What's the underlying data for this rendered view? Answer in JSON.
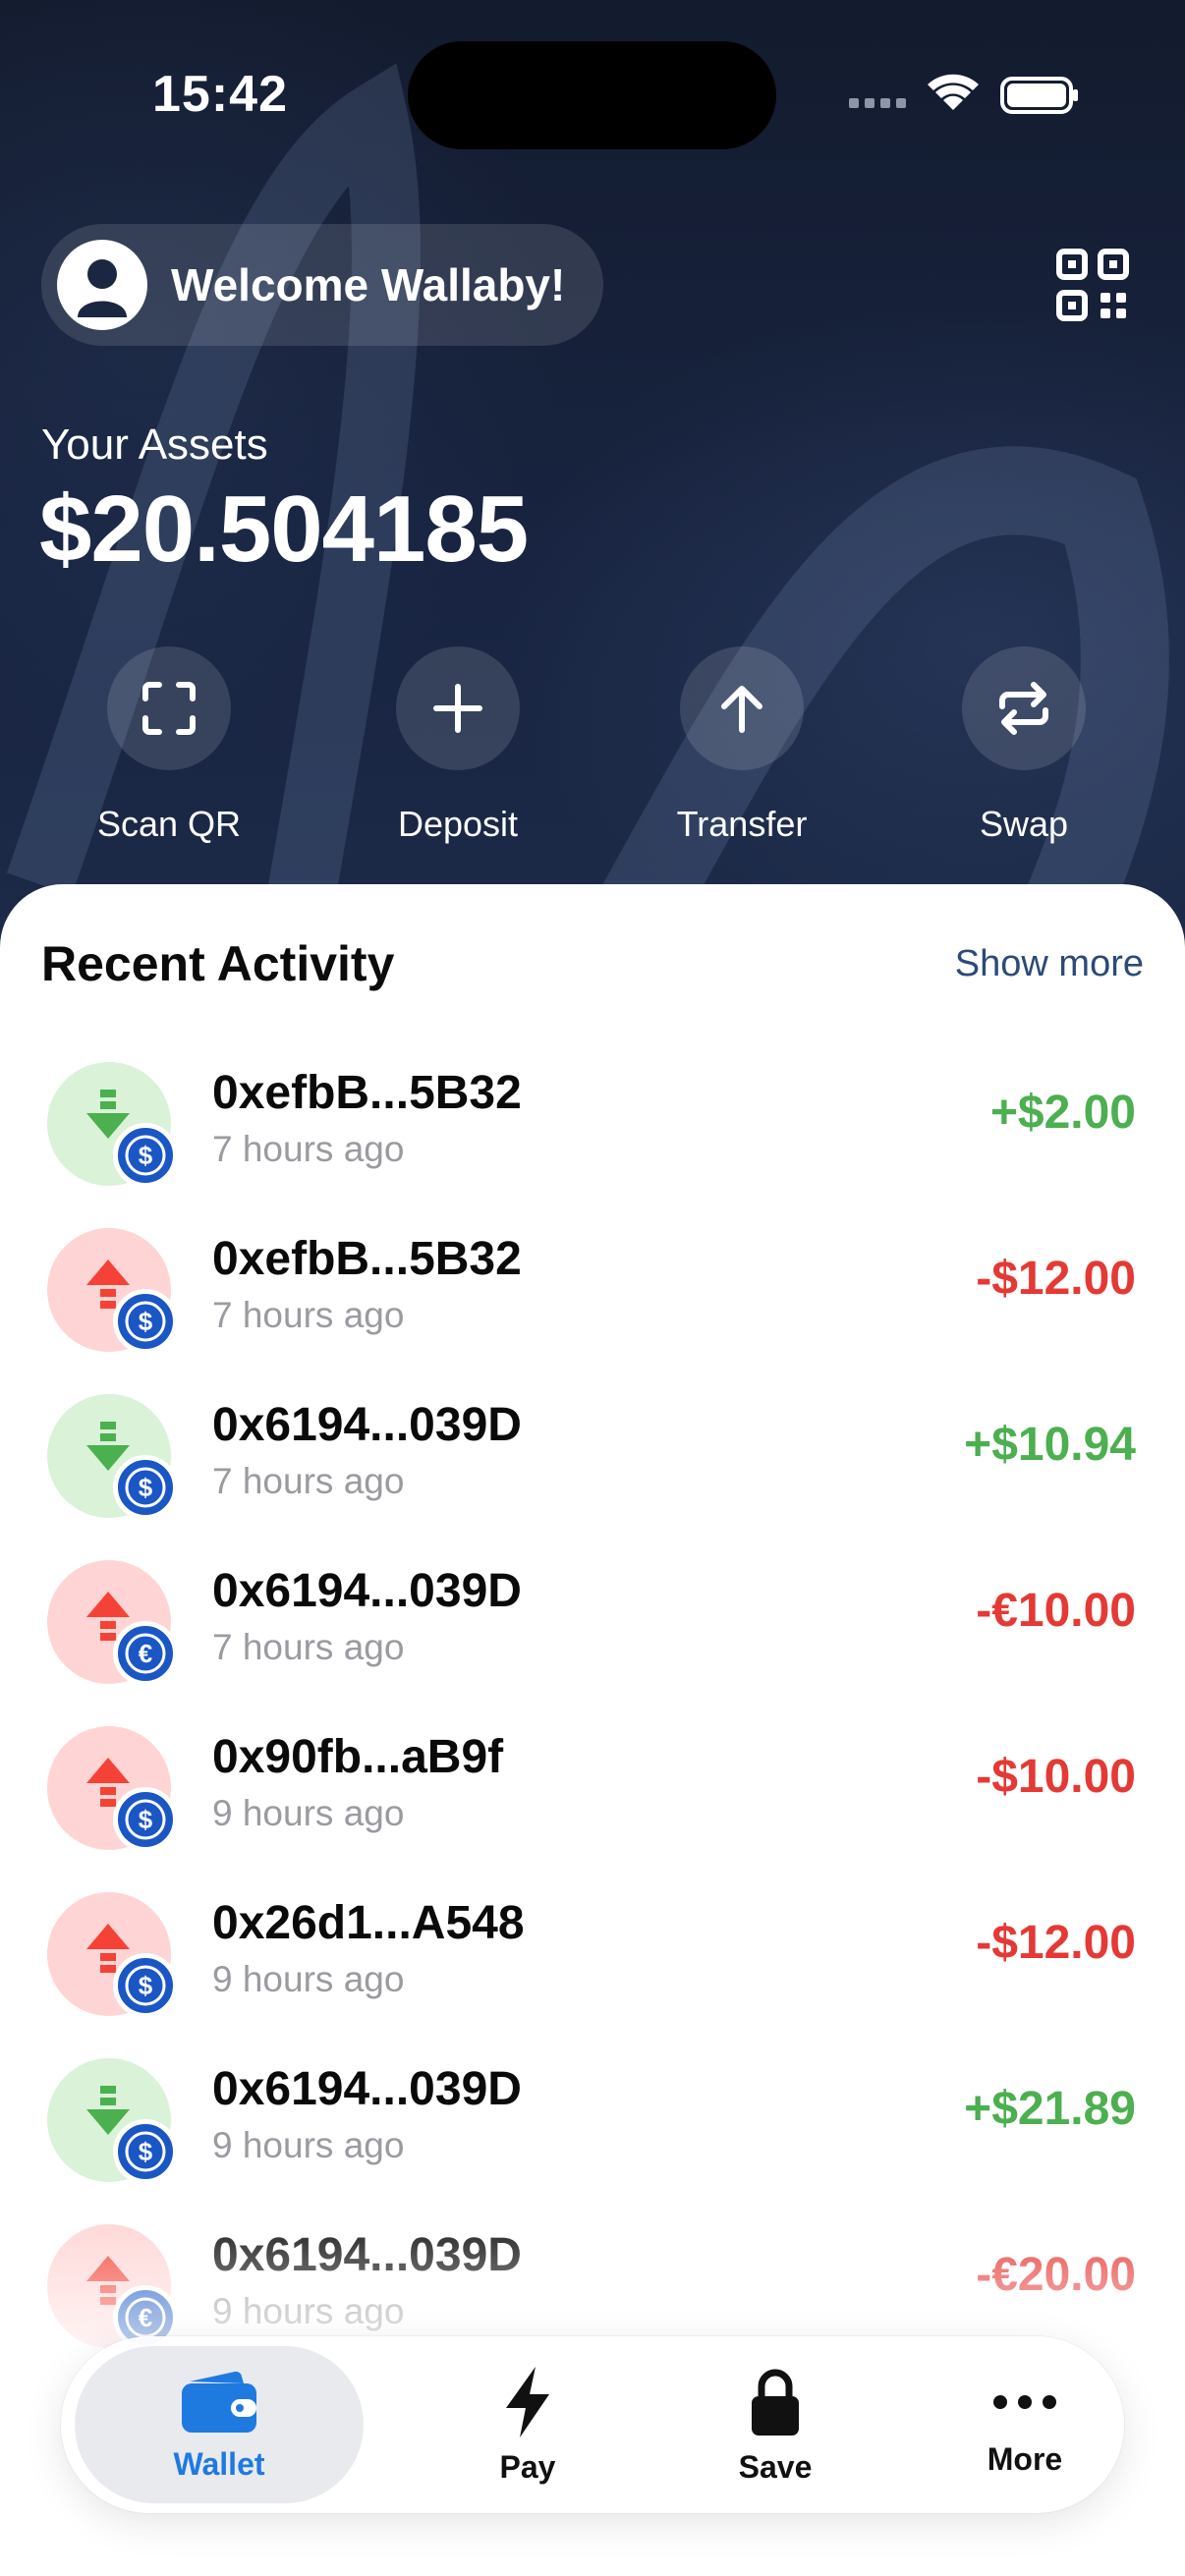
{
  "status": {
    "time": "15:42"
  },
  "header": {
    "welcome": "Welcome Wallaby!"
  },
  "assets": {
    "label": "Your Assets",
    "value": "$20.504185"
  },
  "actions": [
    {
      "label": "Scan QR",
      "icon": "scan-icon"
    },
    {
      "label": "Deposit",
      "icon": "plus-icon"
    },
    {
      "label": "Transfer",
      "icon": "arrow-up-icon"
    },
    {
      "label": "Swap",
      "icon": "swap-icon"
    }
  ],
  "activity": {
    "title": "Recent Activity",
    "show_more": "Show more",
    "items": [
      {
        "address": "0xefbB...5B32",
        "time": "7 hours ago",
        "amount": "+$2.00",
        "direction": "in",
        "currency": "$"
      },
      {
        "address": "0xefbB...5B32",
        "time": "7 hours ago",
        "amount": "-$12.00",
        "direction": "out",
        "currency": "$"
      },
      {
        "address": "0x6194...039D",
        "time": "7 hours ago",
        "amount": "+$10.94",
        "direction": "in",
        "currency": "$"
      },
      {
        "address": "0x6194...039D",
        "time": "7 hours ago",
        "amount": "-€10.00",
        "direction": "out",
        "currency": "€"
      },
      {
        "address": "0x90fb...aB9f",
        "time": "9 hours ago",
        "amount": "-$10.00",
        "direction": "out",
        "currency": "$"
      },
      {
        "address": "0x26d1...A548",
        "time": "9 hours ago",
        "amount": "-$12.00",
        "direction": "out",
        "currency": "$"
      },
      {
        "address": "0x6194...039D",
        "time": "9 hours ago",
        "amount": "+$21.89",
        "direction": "in",
        "currency": "$"
      },
      {
        "address": "0x6194...039D",
        "time": "9 hours ago",
        "amount": "-€20.00",
        "direction": "out",
        "currency": "€"
      }
    ]
  },
  "nav": {
    "items": [
      {
        "label": "Wallet",
        "icon": "wallet-icon",
        "active": true
      },
      {
        "label": "Pay",
        "icon": "bolt-icon"
      },
      {
        "label": "Save",
        "icon": "lock-icon"
      },
      {
        "label": "More",
        "icon": "more-icon"
      }
    ]
  },
  "colors": {
    "positive": "#4caf50",
    "negative": "#e53935",
    "accent": "#1f7ae0",
    "coin": "#1a56c4"
  }
}
